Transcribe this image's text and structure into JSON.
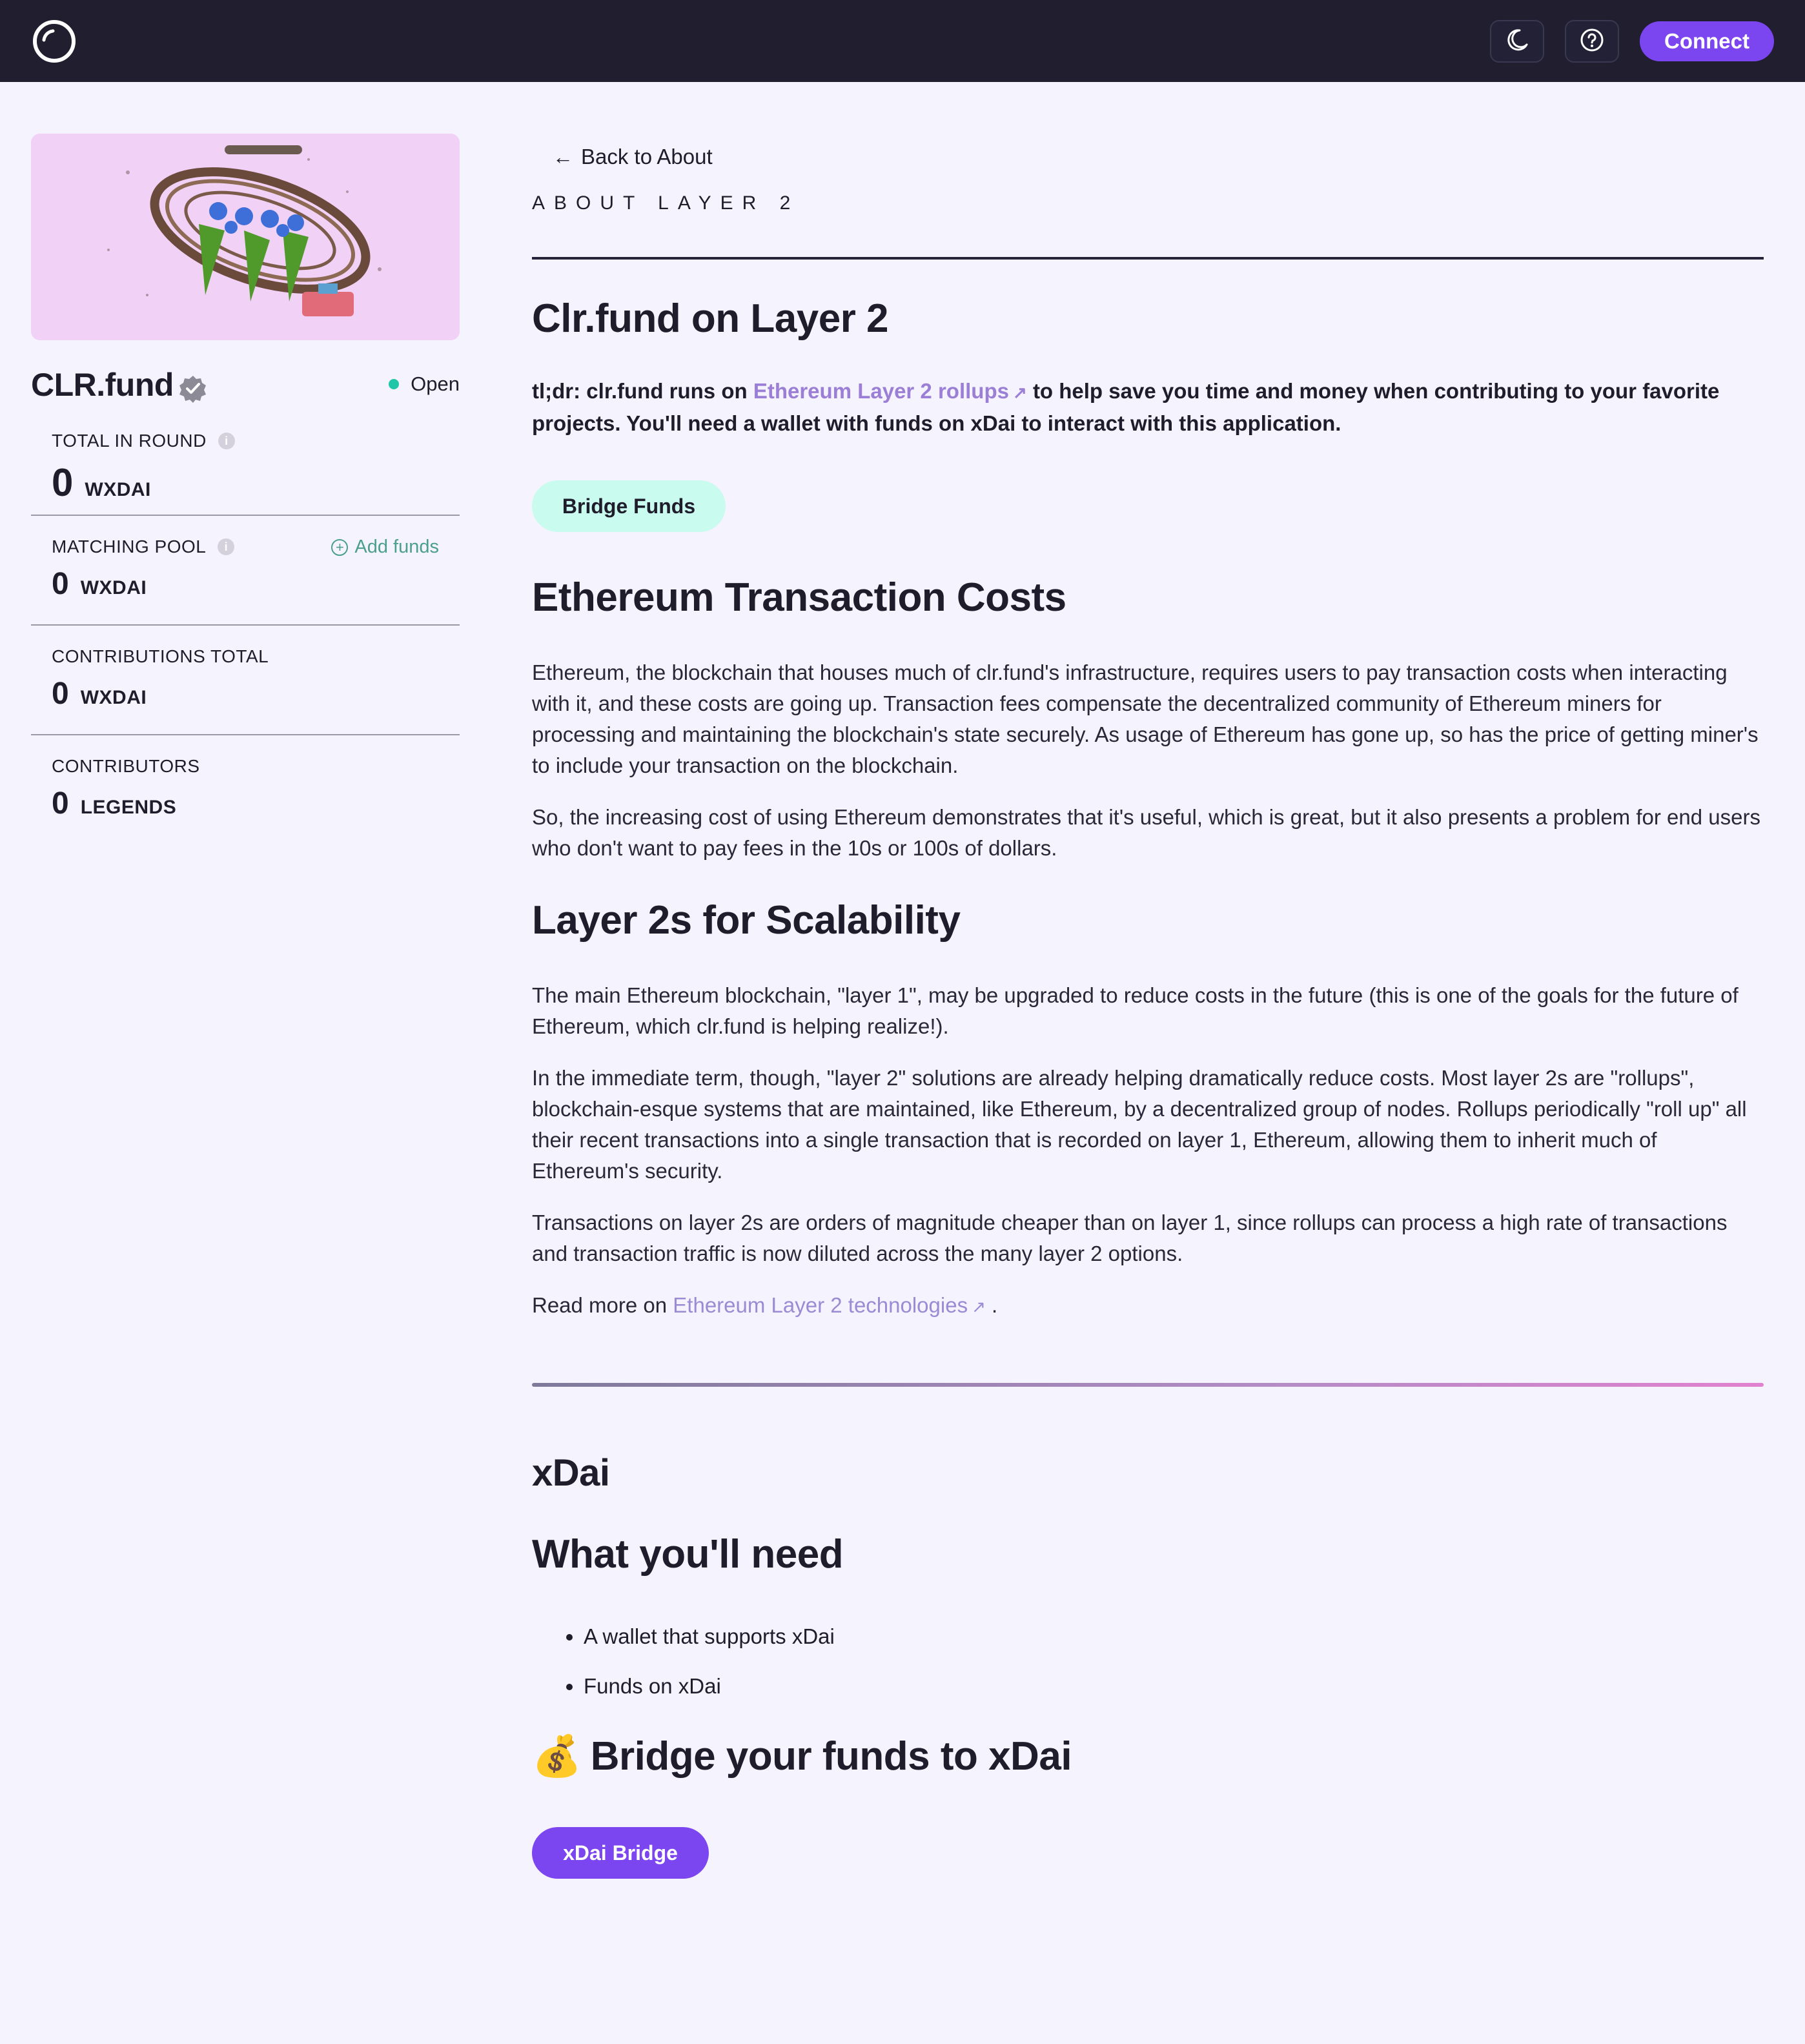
{
  "header": {
    "logo": "clr-fund-logo",
    "theme_icon": "moon-icon",
    "help_icon": "help-icon",
    "connect_label": "Connect"
  },
  "sidebar": {
    "round_name": "CLR.fund",
    "status": "Open",
    "status_color": "#1fc7a8",
    "stats": [
      {
        "label": "TOTAL IN ROUND",
        "value": "0",
        "unit": "WXDAI"
      },
      {
        "label": "MATCHING POOL",
        "value": "0",
        "unit": "WXDAI",
        "action": "Add funds"
      },
      {
        "label": "CONTRIBUTIONS TOTAL",
        "value": "0",
        "unit": "WXDAI"
      },
      {
        "label": "CONTRIBUTORS",
        "value": "0",
        "unit": "LEGENDS"
      }
    ]
  },
  "main": {
    "back_label": "Back to About",
    "eyebrow": "ABOUT LAYER 2",
    "title": "Clr.fund on Layer 2",
    "tldr_prefix": "tl;dr: clr.fund runs on",
    "tldr_link": "Ethereum Layer 2 rollups",
    "tldr_suffix": "to help save you time and money when contributing to your favorite projects. You'll need a wallet with funds on xDai to interact with this application.",
    "bridge_funds_label": "Bridge Funds",
    "costs_heading": "Ethereum Transaction Costs",
    "costs_p1": "Ethereum, the blockchain that houses much of clr.fund's infrastructure, requires users to pay transaction costs when interacting with it, and these costs are going up. Transaction fees compensate the decentralized community of Ethereum miners for processing and maintaining the blockchain's state securely. As usage of Ethereum has gone up, so has the price of getting miner's to include your transaction on the blockchain.",
    "costs_p2": "So, the increasing cost of using Ethereum demonstrates that it's useful, which is great, but it also presents a problem for end users who don't want to pay fees in the 10s or 100s of dollars.",
    "scal_heading": "Layer 2s for Scalability",
    "scal_p1": "The main Ethereum blockchain, \"layer 1\", may be upgraded to reduce costs in the future (this is one of the goals for the future of Ethereum, which clr.fund is helping realize!).",
    "scal_p2": "In the immediate term, though, \"layer 2\" solutions are already helping dramatically reduce costs. Most layer 2s are \"rollups\", blockchain-esque systems that are maintained, like Ethereum, by a decentralized group of nodes. Rollups periodically \"roll up\" all their recent transactions into a single transaction that is recorded on layer 1, Ethereum, allowing them to inherit much of Ethereum's security.",
    "scal_p3": "Transactions on layer 2s are orders of magnitude cheaper than on layer 1, since rollups can process a high rate of transactions and transaction traffic is now diluted across the many layer 2 options.",
    "read_more_prefix": "Read more on",
    "read_more_link": "Ethereum Layer 2 technologies",
    "read_more_suffix": ".",
    "xdai_heading": "xDai",
    "need_heading": "What you'll need",
    "needs": [
      "A wallet that supports xDai",
      "Funds on xDai"
    ],
    "bridge_emoji": "💰",
    "bridge_heading": "Bridge your funds to xDai",
    "xdai_bridge_label": "xDai Bridge"
  },
  "colors": {
    "accent": "#7b45f0",
    "header_bg": "#201e2f",
    "page_bg": "#f5f3fe",
    "mint": "#c9fbef",
    "link": "#9b7ed6"
  }
}
